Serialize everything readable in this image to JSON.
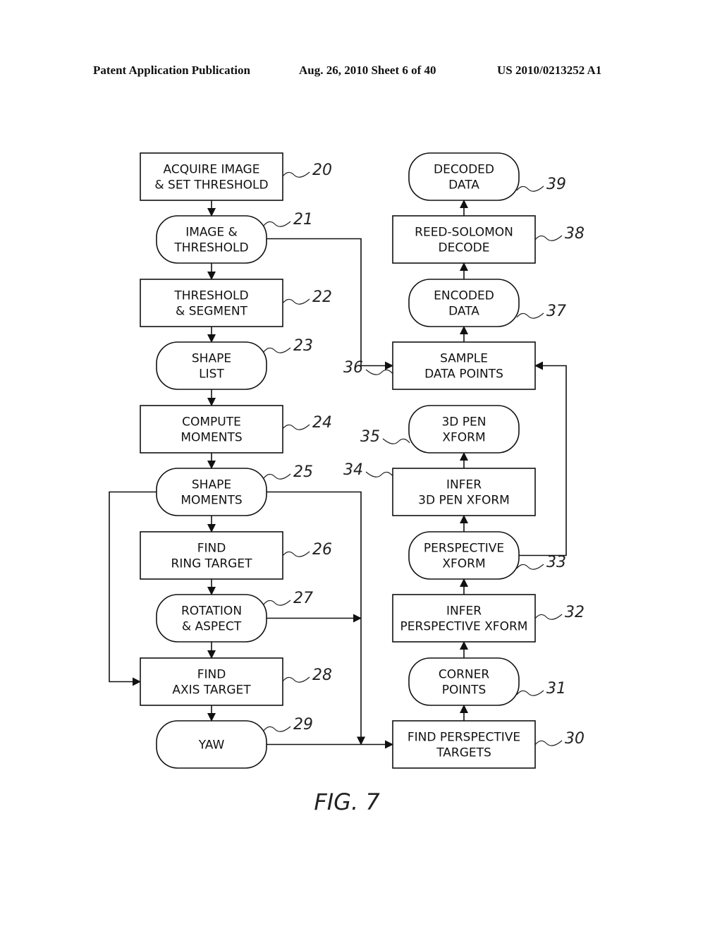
{
  "header": {
    "left": "Patent Application Publication",
    "center": "Aug. 26, 2010  Sheet 6 of 40",
    "right": "US 2010/0213252 A1"
  },
  "figure_label": "FIG. 7",
  "nodes": {
    "n20": {
      "ref": "20",
      "shape": "rect",
      "lines": [
        "ACQUIRE IMAGE",
        "& SET THRESHOLD"
      ]
    },
    "n21": {
      "ref": "21",
      "shape": "rounded",
      "lines": [
        "IMAGE &",
        "THRESHOLD"
      ]
    },
    "n22": {
      "ref": "22",
      "shape": "rect",
      "lines": [
        "THRESHOLD",
        "& SEGMENT"
      ]
    },
    "n23": {
      "ref": "23",
      "shape": "rounded",
      "lines": [
        "SHAPE",
        "LIST"
      ]
    },
    "n24": {
      "ref": "24",
      "shape": "rect",
      "lines": [
        "COMPUTE",
        "MOMENTS"
      ]
    },
    "n25": {
      "ref": "25",
      "shape": "rounded",
      "lines": [
        "SHAPE",
        "MOMENTS"
      ]
    },
    "n26": {
      "ref": "26",
      "shape": "rect",
      "lines": [
        "FIND",
        "RING TARGET"
      ]
    },
    "n27": {
      "ref": "27",
      "shape": "rounded",
      "lines": [
        "ROTATION",
        "& ASPECT"
      ]
    },
    "n28": {
      "ref": "28",
      "shape": "rect",
      "lines": [
        "FIND",
        "AXIS TARGET"
      ]
    },
    "n29": {
      "ref": "29",
      "shape": "rounded",
      "lines": [
        "YAW"
      ]
    },
    "n30": {
      "ref": "30",
      "shape": "rect",
      "lines": [
        "FIND PERSPECTIVE",
        "TARGETS"
      ]
    },
    "n31": {
      "ref": "31",
      "shape": "rounded",
      "lines": [
        "CORNER",
        "POINTS"
      ]
    },
    "n32": {
      "ref": "32",
      "shape": "rect",
      "lines": [
        "INFER",
        "PERSPECTIVE XFORM"
      ]
    },
    "n33": {
      "ref": "33",
      "shape": "rounded",
      "lines": [
        "PERSPECTIVE",
        "XFORM"
      ]
    },
    "n34": {
      "ref": "34",
      "shape": "rect",
      "lines": [
        "INFER",
        "3D PEN XFORM"
      ]
    },
    "n35": {
      "ref": "35",
      "shape": "rounded",
      "lines": [
        "3D PEN",
        "XFORM"
      ]
    },
    "n36": {
      "ref": "36",
      "shape": "rect",
      "lines": [
        "SAMPLE",
        "DATA POINTS"
      ]
    },
    "n37": {
      "ref": "37",
      "shape": "rounded",
      "lines": [
        "ENCODED",
        "DATA"
      ]
    },
    "n38": {
      "ref": "38",
      "shape": "rect",
      "lines": [
        "REED-SOLOMON",
        "DECODE"
      ]
    },
    "n39": {
      "ref": "39",
      "shape": "rounded",
      "lines": [
        "DECODED",
        "DATA"
      ]
    }
  },
  "edges": [
    [
      "n20",
      "n21"
    ],
    [
      "n21",
      "n22"
    ],
    [
      "n22",
      "n23"
    ],
    [
      "n23",
      "n24"
    ],
    [
      "n24",
      "n25"
    ],
    [
      "n25",
      "n26"
    ],
    [
      "n26",
      "n27"
    ],
    [
      "n27",
      "n28"
    ],
    [
      "n28",
      "n29"
    ],
    [
      "n25",
      "n28"
    ],
    [
      "n25",
      "n30"
    ],
    [
      "n27",
      "n30"
    ],
    [
      "n29",
      "n30"
    ],
    [
      "n30",
      "n31"
    ],
    [
      "n31",
      "n32"
    ],
    [
      "n32",
      "n33"
    ],
    [
      "n33",
      "n34"
    ],
    [
      "n34",
      "n35"
    ],
    [
      "n21",
      "n36"
    ],
    [
      "n33",
      "n36"
    ],
    [
      "n36",
      "n37"
    ],
    [
      "n37",
      "n38"
    ],
    [
      "n38",
      "n39"
    ]
  ]
}
